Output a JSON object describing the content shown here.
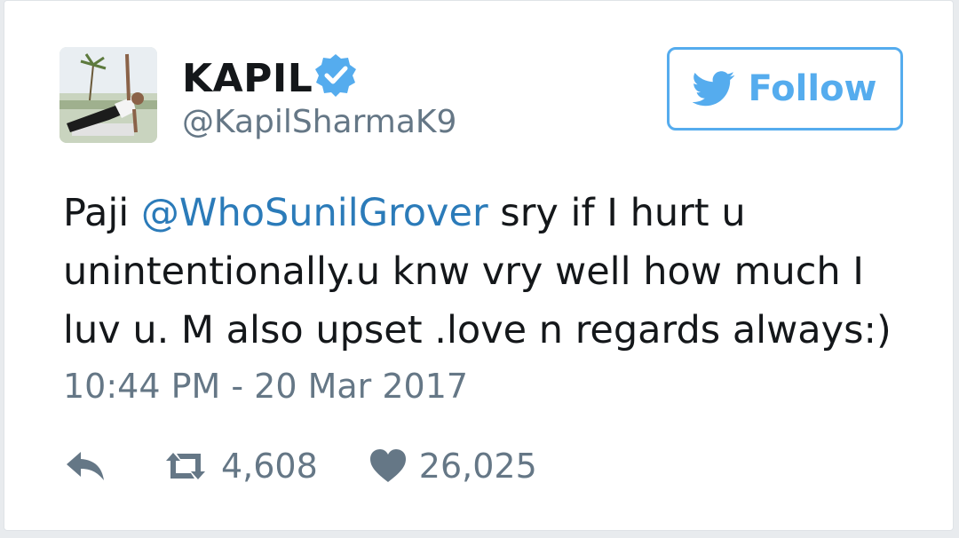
{
  "tweet": {
    "display_name": "KAPIL",
    "handle": "@KapilSharmaK9",
    "follow_label": "Follow",
    "text_before": "Paji ",
    "mention": "@WhoSunilGrover",
    "text_after": " sry if I hurt u unintentionally.u knw vry well how much I luv u. M also upset .love n regards always:)",
    "timestamp": "10:44 PM - 20 Mar 2017",
    "retweets": "4,608",
    "likes": "26,025"
  },
  "colors": {
    "twitter_blue": "#55acee",
    "mention_blue": "#2b7bb9",
    "text_dark": "#14171a",
    "text_muted": "#657786"
  },
  "icons": {
    "verified": "verified-badge-icon",
    "follow": "twitter-bird-icon",
    "reply": "reply-icon",
    "retweet": "retweet-icon",
    "like": "heart-icon"
  }
}
